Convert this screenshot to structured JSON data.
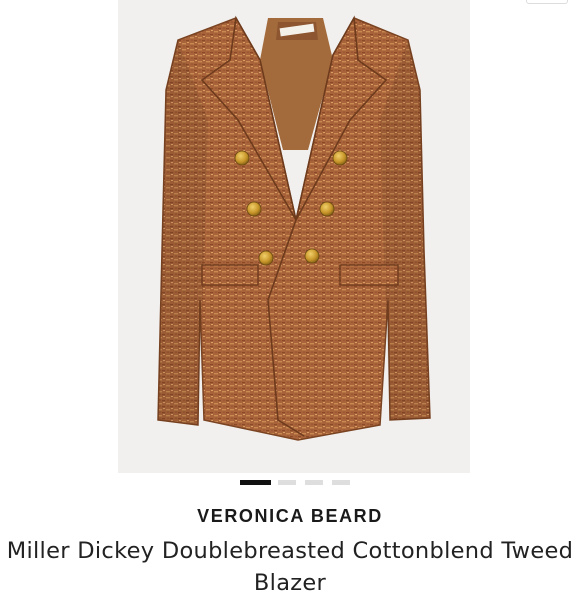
{
  "product": {
    "brand": "VERONICA BEARD",
    "title": "Miller Dickey Doublebreasted Cottonblend Tweed Blazer",
    "image_alt": "Brown tweed double-breasted blazer with gold buttons and frayed trim",
    "garment_label": "VERONICA BEARD"
  },
  "carousel": {
    "total": 4,
    "active_index": 0
  },
  "colors": {
    "tweed": "#a8633a",
    "tweed_dark": "#7a4322",
    "lining": "#a36a3c",
    "buttons": "#c8962a",
    "background": "#f1f0ee"
  }
}
